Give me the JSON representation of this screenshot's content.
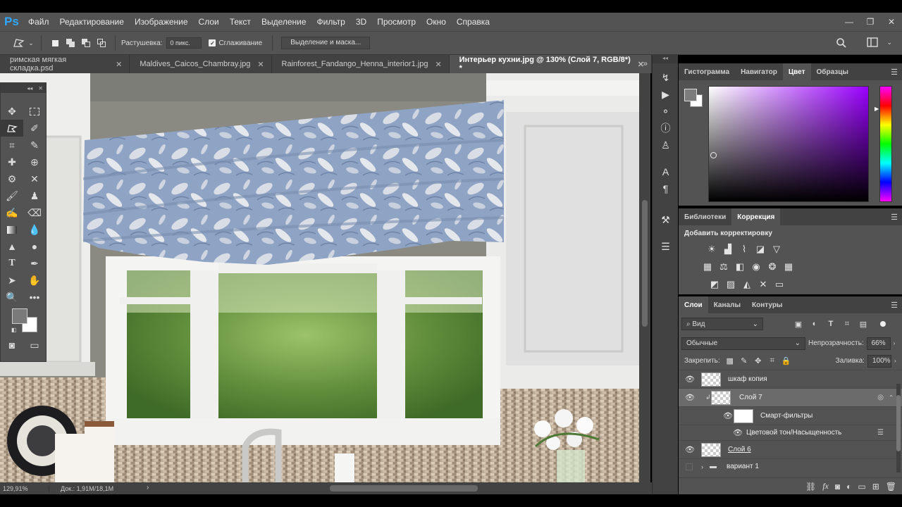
{
  "app": {
    "logo": "Ps"
  },
  "menu": [
    "Файл",
    "Редактирование",
    "Изображение",
    "Слои",
    "Текст",
    "Выделение",
    "Фильтр",
    "3D",
    "Просмотр",
    "Окно",
    "Справка"
  ],
  "window_controls": {
    "minimize": "—",
    "restore": "❐",
    "close": "✕"
  },
  "options": {
    "feather_label": "Растушевка:",
    "feather_value": "0 пикс.",
    "antialias_label": "Сглаживание",
    "antialias_checked": true,
    "mask_button": "Выделение и маска..."
  },
  "tabs": [
    {
      "label": "римская мягкая складка.psd",
      "active": false
    },
    {
      "label": "Maldives_Caicos_Chambray.jpg",
      "active": false
    },
    {
      "label": "Rainforest_Fandango_Henna_interior1.jpg",
      "active": false
    },
    {
      "label": "Интерьер кухни.jpg @ 130% (Слой 7, RGB/8*) *",
      "active": true
    }
  ],
  "tab_close": "✕",
  "tab_overflow": "»",
  "status": {
    "zoom": "129,91%",
    "doc": "Док.: 1,91M/18,1M"
  },
  "color_panel": {
    "tabs": [
      "Гистограмма",
      "Навигатор",
      "Цвет",
      "Образцы"
    ],
    "active_tab": "Цвет",
    "hue_color": "#9a00ff"
  },
  "adjust_panel": {
    "tabs": [
      "Библиотеки",
      "Коррекция"
    ],
    "active_tab": "Коррекция",
    "title": "Добавить корректировку"
  },
  "layers_panel": {
    "tabs": [
      "Слои",
      "Каналы",
      "Контуры"
    ],
    "active_tab": "Слои",
    "filter_kind": "Вид",
    "blend_mode": "Обычные",
    "opacity_label": "Непрозрачность:",
    "opacity_value": "66%",
    "lock_label": "Закрепить:",
    "fill_label": "Заливка:",
    "fill_value": "100%",
    "layers": [
      {
        "name": "шкаф копия"
      },
      {
        "name": "Слой 7"
      },
      {
        "name": "Смарт-фильтры"
      },
      {
        "name": "Цветовой тон/Насыщенность"
      },
      {
        "name": "Слой 6"
      },
      {
        "name": "вариант 1"
      }
    ]
  }
}
